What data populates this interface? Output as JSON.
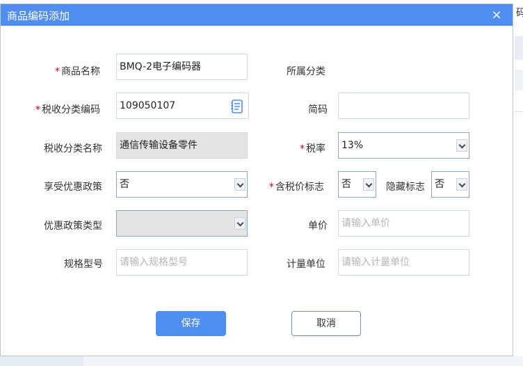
{
  "background": {
    "fragment_text": "码"
  },
  "dialog": {
    "title": "商品编码添加",
    "close_symbol": "×"
  },
  "form": {
    "product_name": {
      "label": "商品名称",
      "required": "*",
      "value": "BMQ-2电子编码器"
    },
    "category": {
      "label": "所属分类"
    },
    "tax_code": {
      "label": "税收分类编码",
      "required": "*",
      "value": "109050107",
      "icon": "book-icon"
    },
    "short_code": {
      "label": "简码",
      "value": ""
    },
    "tax_name": {
      "label": "税收分类名称",
      "value": "通信传输设备零件"
    },
    "tax_rate": {
      "label": "税率",
      "required": "*",
      "value": "13%"
    },
    "preferential": {
      "label": "享受优惠政策",
      "value": "否"
    },
    "tax_included": {
      "label": "含税价标志",
      "required": "*",
      "value": "否"
    },
    "hidden_flag": {
      "label": "隐藏标志",
      "value": "否"
    },
    "policy_type": {
      "label": "优惠政策类型",
      "value": ""
    },
    "unit_price": {
      "label": "单价",
      "placeholder": "请输入单价"
    },
    "spec": {
      "label": "规格型号",
      "placeholder": "请输入规格型号"
    },
    "unit": {
      "label": "计量单位",
      "placeholder": "请输入计量单位"
    }
  },
  "buttons": {
    "save": "保存",
    "cancel": "取消"
  },
  "colors": {
    "accent": "#4f8ef0",
    "required": "#d0021b",
    "disabled": "#e4e4e4"
  }
}
